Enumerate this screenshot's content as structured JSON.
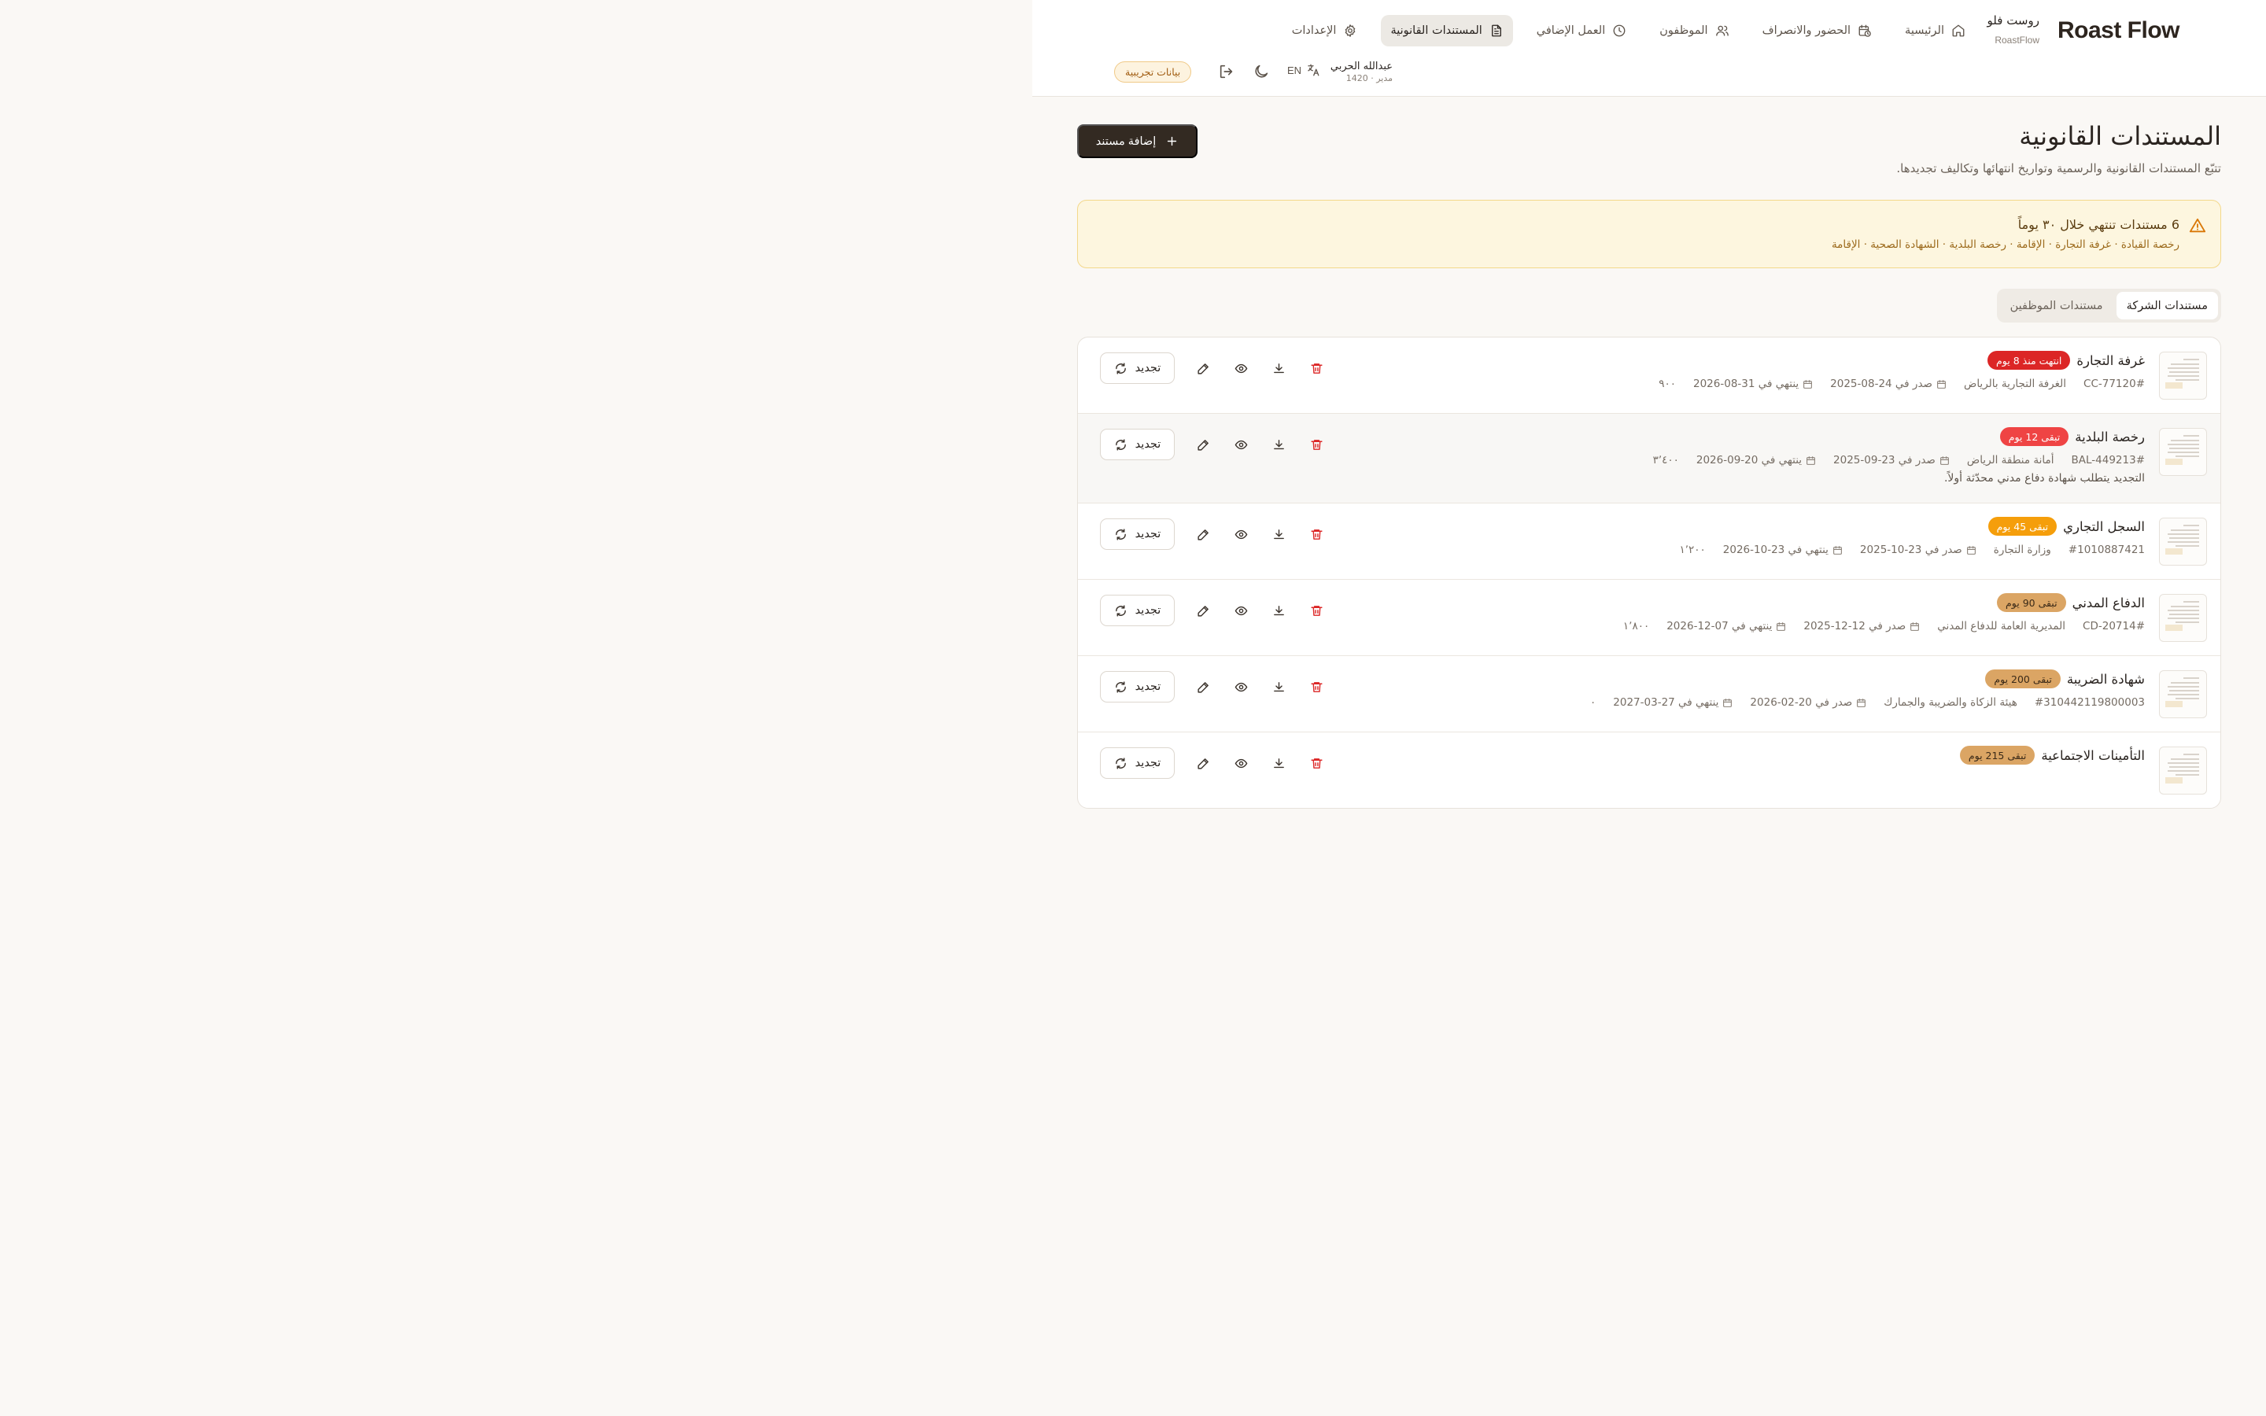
{
  "brand": {
    "logo": "Roast Flow",
    "name_ar": "روست فلو",
    "name_en": "RoastFlow"
  },
  "nav": [
    {
      "label": "الرئيسية",
      "icon": "home-icon"
    },
    {
      "label": "الحضور والانصراف",
      "icon": "calendar-clock-icon"
    },
    {
      "label": "الموظفون",
      "icon": "users-icon"
    },
    {
      "label": "العمل الإضافي",
      "icon": "clock-icon"
    },
    {
      "label": "المستندات القانونية",
      "icon": "file-text-icon",
      "active": true
    },
    {
      "label": "الإعدادات",
      "icon": "gear-icon"
    }
  ],
  "user": {
    "name": "عبدالله الحربي",
    "role": "مدير · 1420"
  },
  "lang_label": "EN",
  "demo_badge": "بيانات تجريبية",
  "page": {
    "title": "المستندات القانونية",
    "subtitle": "تتبّع المستندات القانونية والرسمية وتواريخ انتهائها وتكاليف تجديدها.",
    "add_button": "إضافة مستند"
  },
  "alert": {
    "title": "6 مستندات تنتهي خلال ٣٠ يوماً",
    "list": "رخصة القيادة · غرفة التجارة · الإقامة · رخصة البلدية · الشهادة الصحية · الإقامة"
  },
  "tabs": [
    {
      "label": "مستندات الشركة",
      "active": true
    },
    {
      "label": "مستندات الموظفين",
      "active": false
    }
  ],
  "renew_label": "تجديد",
  "documents": [
    {
      "name": "غرفة التجارة",
      "badge": "انتهت منذ 8 يوم",
      "status": "expired",
      "number": "#CC-77120",
      "issuer": "الغرفة التجارية بالرياض",
      "issued": "صدر في 24-08-2025",
      "expires": "ينتهي في 31-08-2026",
      "cost": "٩٠٠",
      "note": ""
    },
    {
      "name": "رخصة البلدية",
      "badge": "تبقى 12 يوم",
      "status": "critical",
      "number": "#BAL-449213",
      "issuer": "أمانة منطقة الرياض",
      "issued": "صدر في 23-09-2025",
      "expires": "ينتهي في 20-09-2026",
      "cost": "٣٬٤٠٠",
      "note": "التجديد يتطلب شهادة دفاع مدني محدّثة أولاً."
    },
    {
      "name": "السجل التجاري",
      "badge": "تبقى 45 يوم",
      "status": "warning",
      "number": "#1010887421",
      "issuer": "وزارة التجارة",
      "issued": "صدر في 23-10-2025",
      "expires": "ينتهي في 23-10-2026",
      "cost": "١٬٢٠٠",
      "note": ""
    },
    {
      "name": "الدفاع المدني",
      "badge": "تبقى 90 يوم",
      "status": "ok",
      "number": "#CD-20714",
      "issuer": "المديرية العامة للدفاع المدني",
      "issued": "صدر في 12-12-2025",
      "expires": "ينتهي في 07-12-2026",
      "cost": "١٬٨٠٠",
      "note": ""
    },
    {
      "name": "شهادة الضريبة",
      "badge": "تبقى 200 يوم",
      "status": "ok",
      "number": "#310442119800003",
      "issuer": "هيئة الزكاة والضريبة والجمارك",
      "issued": "صدر في 20-02-2026",
      "expires": "ينتهي في 27-03-2027",
      "cost": "٠",
      "note": ""
    },
    {
      "name": "التأمينات الاجتماعية",
      "badge": "تبقى 215 يوم",
      "status": "ok",
      "number": "",
      "issuer": "",
      "issued": "",
      "expires": "",
      "cost": "",
      "note": ""
    }
  ],
  "colors": {
    "primary_dark": "#332a22",
    "expired": "#dc2626",
    "critical": "#ef4444",
    "warning": "#f59e0b",
    "ok": "#dba564",
    "alert_bg": "#fdf6df"
  }
}
